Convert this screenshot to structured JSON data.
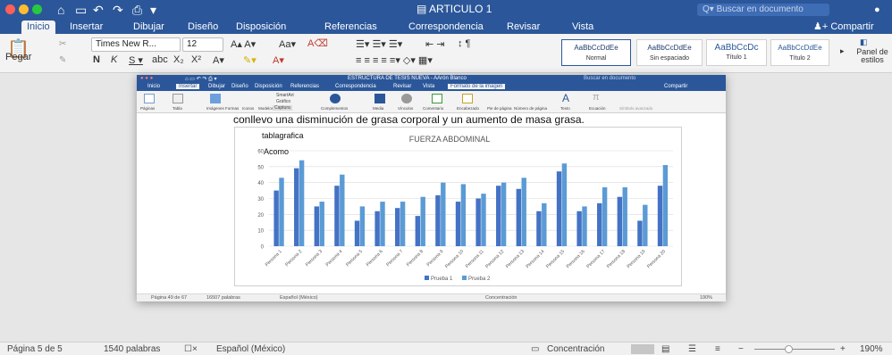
{
  "app": {
    "doc_title": "ARTICULO 1",
    "search_placeholder": "Buscar en documento",
    "share": "Compartir"
  },
  "tabs": [
    "Inicio",
    "Insertar",
    "Dibujar",
    "Diseño",
    "Disposición",
    "Referencias",
    "Correspondencia",
    "Revisar",
    "Vista"
  ],
  "ribbon": {
    "paste": "Pegar",
    "font": "Times New R...",
    "size": "12",
    "styles": [
      {
        "sample": "AaBbCcDdEe",
        "name": "Normal"
      },
      {
        "sample": "AaBbCcDdEe",
        "name": "Sin espaciado"
      },
      {
        "sample": "AaBbCcDc",
        "name": "Título 1"
      },
      {
        "sample": "AaBbCcDdEe",
        "name": "Título 2"
      }
    ],
    "panel": "Panel de estilos"
  },
  "inner": {
    "title": "ESTRUCTURA DE TESIS NUEVA - AArón Blanco",
    "search": "Buscar en documento",
    "share": "Compartir",
    "tabs": [
      "Inicio",
      "Insertar",
      "Dibujar",
      "Diseño",
      "Disposición",
      "Referencias",
      "Correspondencia",
      "Revisar",
      "Vista",
      "Formato de la imagen"
    ],
    "ribbon": [
      "Páginas",
      "Tabla",
      "Imágenes",
      "Formas",
      "Iconos",
      "Modelos 3D",
      "SmartArt",
      "Gráfico",
      "Captura",
      "Complementos",
      "Media",
      "Vínculos",
      "Comentario",
      "Encabezado",
      "Pie de página",
      "Número de página",
      "Texto",
      "Ecuación",
      "Símbolo avanzado"
    ],
    "body_text": "conllevo una disminución de grasa corporal y un aumento de masa grasa.",
    "status": {
      "page": "Página 49 de 67",
      "words": "16507 palabras",
      "lang": "Español (México)",
      "focus": "Concentración",
      "zoom": "190%"
    }
  },
  "chart_data": {
    "type": "bar",
    "title": "FUERZA ABDOMINAL",
    "annotations": [
      "tablagrafica",
      "Acomo"
    ],
    "categories": [
      "Persona 1",
      "Persona 2",
      "Persona 3",
      "Persona 4",
      "Persona 5",
      "Persona 6",
      "Persona 7",
      "Persona 8",
      "Persona 9",
      "Persona 10",
      "Persona 11",
      "Persona 12",
      "Persona 13",
      "Persona 14",
      "Persona 15",
      "Persona 16",
      "Persona 17",
      "Persona 18",
      "Persona 19",
      "Persona 20"
    ],
    "series": [
      {
        "name": "Prueba 1",
        "color": "#4472c4",
        "values": [
          35,
          49,
          25,
          38,
          16,
          22,
          24,
          19,
          32,
          28,
          30,
          38,
          36,
          22,
          47,
          22,
          27,
          31,
          16,
          38
        ]
      },
      {
        "name": "Prueba 2",
        "color": "#5b9bd5",
        "values": [
          43,
          54,
          28,
          45,
          25,
          28,
          28,
          31,
          40,
          39,
          33,
          40,
          43,
          27,
          52,
          25,
          37,
          37,
          26,
          51
        ]
      }
    ],
    "yticks": [
      0,
      10,
      20,
      30,
      40,
      50,
      60
    ],
    "ylim": [
      0,
      60
    ],
    "grid": true,
    "legend": "bottom"
  },
  "status": {
    "page": "Página 5 de 5",
    "words": "1540 palabras",
    "lang": "Español (México)",
    "focus": "Concentración",
    "zoom": "190%"
  },
  "colors": {
    "brand": "#2b579a"
  }
}
